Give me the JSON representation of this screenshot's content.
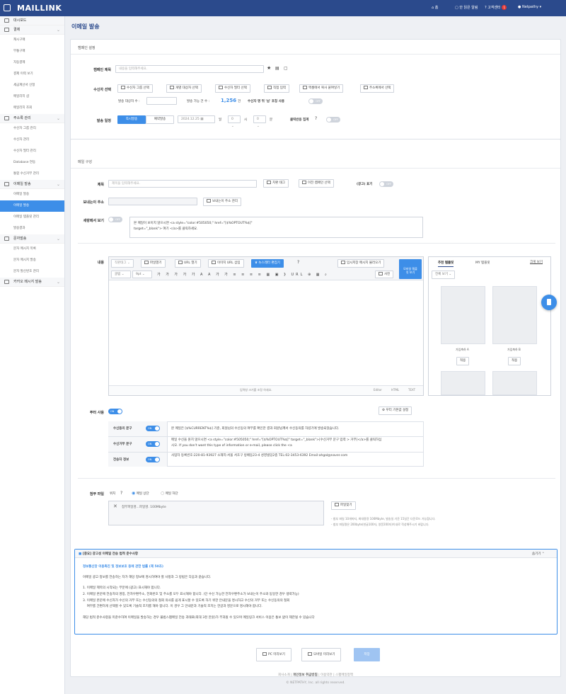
{
  "topbar": {
    "logo": "MAILLINK",
    "home": "홈",
    "unread": "안 읽은 알림",
    "support": "고객센터",
    "support_badge": "1",
    "user": "Netpathy"
  },
  "sidebar": [
    {
      "label": "대시보드",
      "children": []
    },
    {
      "label": "결제",
      "children": [
        "캐시구매",
        "무통구매",
        "자동결제",
        "결제 이력 보기",
        "세금계산서 신청",
        "메일리지 샵",
        "메일리지 조회"
      ]
    },
    {
      "label": "주소록 관리",
      "children": [
        "수신자 그룹 관리",
        "수신자 관리",
        "수신자 필터 관리",
        "Database 연동",
        "통합 수신거부 관리"
      ]
    },
    {
      "label": "이메일 발송",
      "children": [
        "이메일 발송",
        "이메일 발송",
        "이메일 템플릿 관리",
        "발송결과"
      ]
    },
    {
      "label": "문자발송",
      "children": [
        "문자 메시지 목록",
        "문자 메시지 발송",
        "문자 발신번호 관리"
      ]
    },
    {
      "label": "카카오 메시지 발송",
      "children": []
    }
  ],
  "page": {
    "title": "이메일 발송"
  },
  "campaign": {
    "section": "캠페인 설정",
    "name_label": "캠페인 제목",
    "name_placeholder": "내용을 입력해주세요.",
    "recipients_label": "수신자 선택",
    "recipient_buttons": [
      "수신자 그룹 선택",
      "개별 대상자 선택",
      "수신자 필터 선택",
      "직접 입력",
      "엑셀에서 복사 붙여넣기",
      "주소록에서 선택"
    ],
    "target_count_label": "발송 대상자 수 :",
    "available_label": "발송 가능 건 수 :",
    "available_value": "1,256",
    "available_unit": "건",
    "honorific_label": "수신자 명 뒤 '님' 호칭 사용",
    "off": "OFF",
    "schedule_label": "발송 일정",
    "now": "즉시발송",
    "reserve": "예약발송",
    "date": "2024.12.25",
    "day_unit": "일",
    "hour_value": "0",
    "hour_unit": "시",
    "min_value": "0",
    "min_unit": "분",
    "click_label": "클릭반응 집계"
  },
  "mail": {
    "section": "메일 구성",
    "subject_label": "제목",
    "subject_placeholder": "제목을 입력해주세요.",
    "btn_replace": "치환 태그",
    "btn_prev": "이전 캠페인 선택",
    "ad_label": "(광고) 표기",
    "ad_toggle": "OFF",
    "sender_label": "보내는이 주소",
    "sender_btn": "보내는이 주소 관리",
    "fallback_label": "세랑메서 보기",
    "fallback_toggle": "OFF",
    "fallback_text1": "본 메일이 보이지 않으시면 <a style=\"color:#505050;\" href=\"[$%OPTOUT%$]\"",
    "fallback_text2": "target=\"_blank\"> 여기 </a>를 클릭하세요.",
    "content_label": "내용",
    "toolbar1": [
      "직판태그",
      "파일열기",
      "URL 열기",
      "이미지 URL 삽입",
      "뉴스레터 편집기"
    ],
    "temp_load": "임시저장 메시지 불러오기",
    "mobile_btn": "모바일 템플릿 보기",
    "font": "굴림",
    "size": "9pt",
    "img_btn": "사진",
    "resize": "입력창 크기를 조정 하세요.",
    "modes": [
      "Editor",
      "HTML",
      "TEXT"
    ],
    "tabs": [
      "추천 템플릿",
      "MY 템플릿"
    ],
    "expand": "크게 보기",
    "view_all": "전체 보기",
    "templates": [
      "가입축하 A",
      "가입축하 B"
    ],
    "apply": "적용",
    "footer_label": "푸터 사용",
    "footer_toggle": "ON",
    "footer_settings": "푸터 기본값 설정",
    "footer_rows": [
      {
        "label": "수신동의 문구",
        "toggle": "ON",
        "text": "본 메일은 [$%CURRENT%$] 기준, 회원님의 수신동의 여부를 확인한 결과 회원님께서 수신동의를 하셨기에 발송되었습니다."
      },
      {
        "label": "수신거부 문구",
        "toggle": "ON",
        "text": "메일 수신을 원치 않으시면 <a style=\"color:#505050;\" href=\"[$%OPTOUT%$]\" target=\"_blank\">[수신거부 문구 입력 > 거부]</a>를 클릭하십시오. If you don't want this type of information or e-mail, please click the <a"
      },
      {
        "label": "전송자 정보",
        "toggle": "ON",
        "text": "사업자 등록번호:220-81-93927 소재지:서울 서초구 방배동23-4 성영빌딩2층 TEL:02-3453-6392 Email:ahgal@naver.com"
      }
    ],
    "attach_label": "첨부 파일",
    "position_label": "위치",
    "pos_top": "메일 상단",
    "pos_bottom": "메일 하단",
    "attach_hint": "첨부파일명...파일명. 100Mbyte",
    "file_btn": "파일찾기",
    "attach_note1": "- 첨부 파일 10개까지, 최대용량 100Mbyte, 발송일 기준 15일간 다운로드 가능합니다.",
    "attach_note2": "- 첨부 파일명은 200byte(한글100자, 영문200자)이내로 작성해주시기 바랍니다."
  },
  "legal": {
    "title": "[중요] 광고성 이메일 전송 법적 준수사항",
    "hide": "숨기기",
    "law": "정보통신망 이용촉진 및 정보보호 등에 관한 법률 (제 50조)",
    "intro": "이메일 광고 정보를 전송하는 자가 해당 정보에 명시하여야 할 사항과 그 방법은 다음과 같습니다.",
    "items": [
      "1. 이메일 제목의 시작되는 부분에 (광고) 표시해야 합니다.",
      "2. 이메일 본문에 전송자의 명칭, 전자우편주소, 전화번호 및 주소를 모두 표시해야 합니다. (단 수신 가능한 전자우편주소가 보내는이 주소와 동일한 경우 생략가능)",
      "3. 이메일 본문에 수신자가 수신의 거부 또는 수신동의의 철회 의사를 쉽게 표시할 수 있도록 하기 위한 안내문을 명시하고 수신의 거부 또는 수신동의의 철회",
      "    여부를 간편하게 선택할 수 있도록 기술적 조치를 해야 합니다. 이 경우 그 안내문과 기술적 조치는 한글과 영문으로 명시해야 합니다."
    ],
    "penalty": "해당 법적 준수사항을 미준수하여 이메일을 발송하는 경우 불법스팸메일 전송 과태료(최대 3천 만원)가 부과될 수 있으며 메일링크 서비스 이용은 통보 없이 제한될 수 있습니다"
  },
  "actions": {
    "pc": "PC 미리보기",
    "mobile": "모바일 미리보기",
    "save": "저장"
  },
  "footer": {
    "links": [
      "회사소개",
      "개인정보 취급방침",
      "이용약관",
      "스팸메일정책"
    ],
    "copy": "© NETPATHY, Inc. all rights reserved."
  }
}
